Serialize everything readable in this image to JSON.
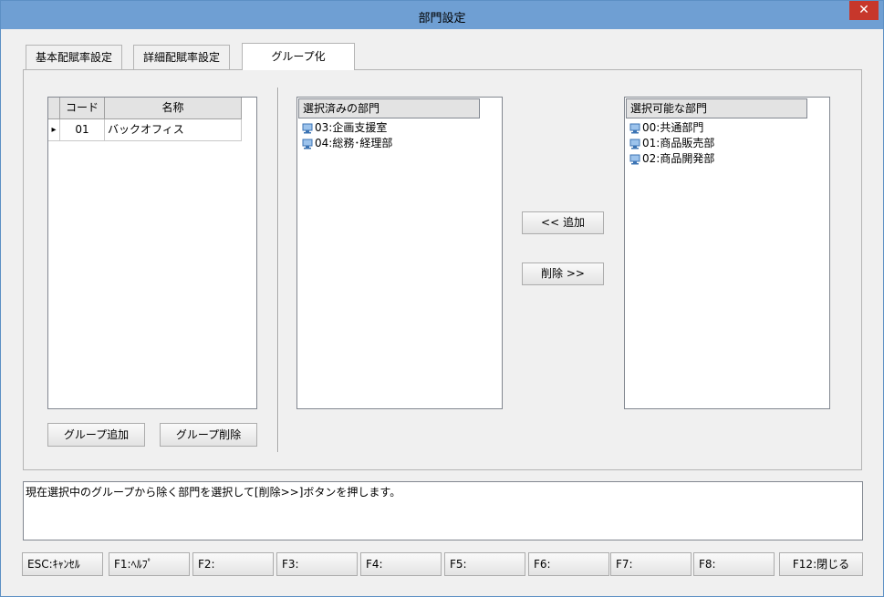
{
  "window": {
    "title": "部門設定",
    "close_label": "✕"
  },
  "tabs": [
    {
      "label": "基本配賦率設定"
    },
    {
      "label": "詳細配賦率設定"
    },
    {
      "label": "グループ化"
    }
  ],
  "group_grid": {
    "columns": [
      "コード",
      "名称"
    ],
    "rows": [
      {
        "indicator": "▸",
        "code": "01",
        "name": "バックオフィス"
      }
    ]
  },
  "group_buttons": {
    "add": "グループ追加",
    "delete": "グループ削除"
  },
  "selected_list": {
    "header": "選択済みの部門",
    "items": [
      "03:企画支援室",
      "04:総務･経理部"
    ]
  },
  "move_buttons": {
    "add": "<< 追加",
    "remove": "削除 >>"
  },
  "available_list": {
    "header": "選択可能な部門",
    "items": [
      "00:共通部門",
      "01:商品販売部",
      "02:商品開発部"
    ]
  },
  "message": "現在選択中のグループから除く部門を選択して[削除>>]ボタンを押します。",
  "function_keys": [
    "ESC:ｷｬﾝｾﾙ",
    "F1:ﾍﾙﾌﾟ",
    "F2:",
    "F3:",
    "F4:",
    "F5:",
    "F6:",
    "F7:",
    "F8:",
    "F12:閉じる"
  ],
  "colors": {
    "titlebar": "#6f9fd3",
    "close": "#c7372b",
    "panel": "#f0f0f0"
  }
}
